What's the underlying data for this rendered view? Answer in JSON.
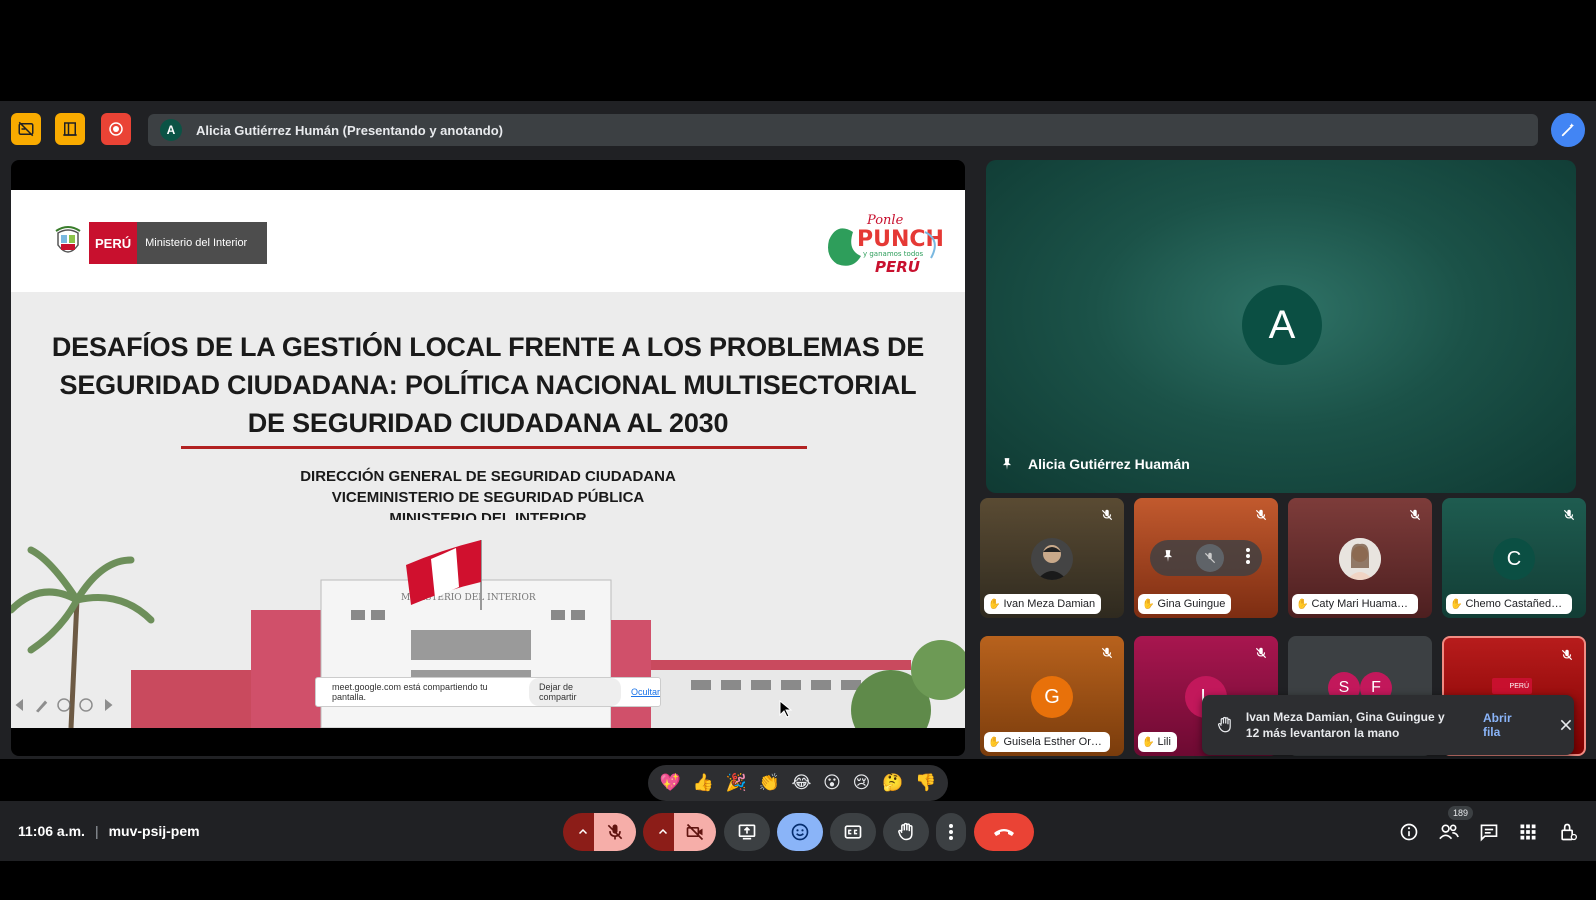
{
  "presenting": {
    "initial": "A",
    "text": "Alicia Gutiérrez Humán (Presentando y anotando)"
  },
  "slide": {
    "logo_peru": "PERÚ",
    "logo_ministerio": "Ministerio del Interior",
    "title_lines": [
      "DESAFÍOS DE LA GESTIÓN LOCAL FRENTE A LOS PROBLEMAS DE",
      "SEGURIDAD CIUDADANA: POLÍTICA NACIONAL MULTISECTORIAL",
      "DE SEGURIDAD CIUDADANA AL 2030"
    ],
    "sub_lines": [
      "DIRECCIÓN GENERAL DE SEGURIDAD CIUDADANA",
      "VICEMINISTERIO DE SEGURIDAD PÚBLICA",
      "MINISTERIO DEL INTERIOR"
    ],
    "building_sign": "MINISTERIO DEL INTERIOR",
    "ponle_top": "Ponle",
    "ponle_mid": "PUNCHE",
    "ponle_small": "y ganamos todos",
    "ponle_bottom": "PERÚ"
  },
  "share_notice": {
    "message": "meet.google.com está compartiendo tu pantalla.",
    "stop_label": "Dejar de compartir",
    "hide_label": "Ocultar"
  },
  "main_tile": {
    "initial": "A",
    "name": "Alicia Gutiérrez Huamán"
  },
  "tiles": [
    {
      "name": "Ivan Meza Damian"
    },
    {
      "name": "Gina Guingue"
    },
    {
      "name": "Caty Mari Huaman C..."
    },
    {
      "name": "Chemo Castañeda v...",
      "initial": "C"
    },
    {
      "name": "Guisela Esther Orih...",
      "initial": "G"
    },
    {
      "name": "Lili",
      "initial": "L"
    },
    {
      "initial_a": "S",
      "initial_b": "F"
    },
    {
      "badge": "PERÚ"
    }
  ],
  "toast": {
    "text": "Ivan Meza Damian, Gina Guingue y 12 más levantaron la mano",
    "action": "Abrir fila"
  },
  "reactions": [
    "💖",
    "👍",
    "🎉",
    "👏",
    "😂",
    "😮",
    "😢",
    "🤔",
    "👎"
  ],
  "footer": {
    "time": "11:06 a.m.",
    "separator": "|",
    "meeting_code": "muv-psij-pem",
    "participants_count": "189"
  },
  "colors": {
    "accent_yellow": "#f9ab00",
    "record_red": "#ea4335",
    "end_call_red": "#ea4335",
    "muted_pill": "#f6aea9",
    "muted_pill_dark": "#8c1d18",
    "emoji_active": "#8ab4f8",
    "bar_bg": "#202124"
  }
}
